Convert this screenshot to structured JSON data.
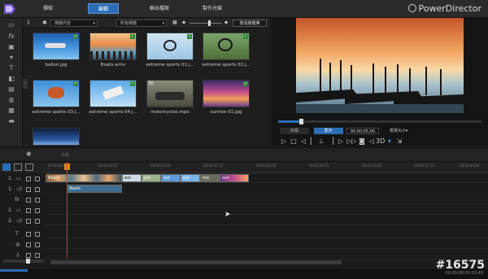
{
  "app": {
    "brand": "PowerDirector"
  },
  "tabs": [
    {
      "label": "擷取",
      "active": false
    },
    {
      "label": "編輯",
      "active": true
    },
    {
      "label": "輸出檔案",
      "active": false
    },
    {
      "label": "製作光碟",
      "active": false
    }
  ],
  "library": {
    "filter1": "媒體內容",
    "filter2": "所有媒體",
    "capture_button": "搜尋媒體庫",
    "items": [
      {
        "label": "ballon.jpg",
        "checked": true
      },
      {
        "label": "Boats.wmv",
        "checked": true
      },
      {
        "label": "extreme sports 01.j...",
        "checked": true
      },
      {
        "label": "extreme sports 02.j...",
        "checked": true
      },
      {
        "label": "extreme sports 03.j...",
        "checked": true
      },
      {
        "label": "extreme sports 04.j...",
        "checked": true
      },
      {
        "label": "motorcycles.mpo",
        "checked": false
      },
      {
        "label": "sunrise 01.jpg",
        "checked": true
      },
      {
        "label": "",
        "checked": false
      }
    ]
  },
  "preview": {
    "mode_clip": "片段",
    "mode_movie": "影片",
    "timecode": "00;00;05;00",
    "size_label": "檢視大小",
    "progress": 0.11
  },
  "divider": {
    "label": "分割"
  },
  "timeline": {
    "ruler": [
      "00;00;00;00",
      "00;00;12;15",
      "00;00;25;00",
      "00;00;37;15",
      "00;00;50;00",
      "00;01;02;15",
      "00;01;15;03",
      "00;01;27;15",
      "00;01;40;00"
    ],
    "tracks": [
      "1.",
      "1.",
      "fx",
      "2.",
      "2.",
      "T",
      "",
      "♫"
    ],
    "clip_video_label": "Boats",
    "clip_audio_label": "Boats",
    "transition_labels": [
      "ext",
      "ext",
      "ext",
      "ext",
      "ext",
      "mo",
      "sun"
    ]
  },
  "status": {
    "timecode": "00;00;08;00;03;49"
  },
  "watermark": "#16575"
}
